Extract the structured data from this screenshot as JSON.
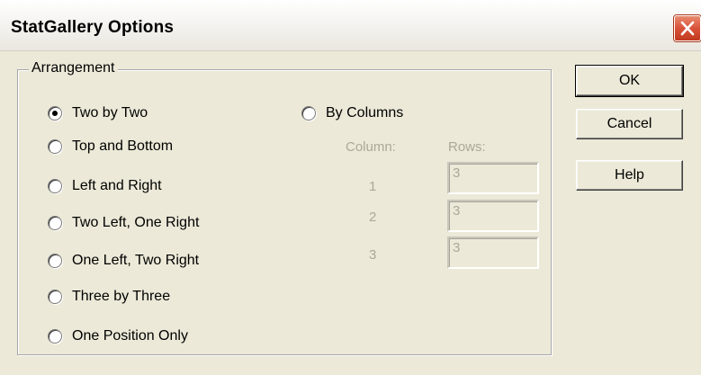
{
  "window": {
    "title": "StatGallery Options",
    "close_icon": "close-icon"
  },
  "arrangement": {
    "label": "Arrangement",
    "selected": "Two by Two",
    "options_left": [
      {
        "label": "Two by Two",
        "checked": true
      },
      {
        "label": "Top and Bottom",
        "checked": false
      },
      {
        "label": "Left and Right",
        "checked": false
      },
      {
        "label": "Two Left, One Right",
        "checked": false
      },
      {
        "label": "One Left, Two Right",
        "checked": false
      },
      {
        "label": "Three by Three",
        "checked": false
      },
      {
        "label": "One Position Only",
        "checked": false
      }
    ],
    "by_columns": {
      "label": "By Columns",
      "checked": false
    },
    "columns_header": "Column:",
    "rows_header": "Rows:",
    "columns": [
      {
        "number": "1",
        "rows": "3"
      },
      {
        "number": "2",
        "rows": "3"
      },
      {
        "number": "3",
        "rows": "3"
      }
    ]
  },
  "buttons": {
    "ok": "OK",
    "cancel": "Cancel",
    "help": "Help"
  },
  "colors": {
    "dialog_bg": "#ece9d8",
    "disabled_text": "#aca899",
    "close_button": "#d9533a"
  }
}
